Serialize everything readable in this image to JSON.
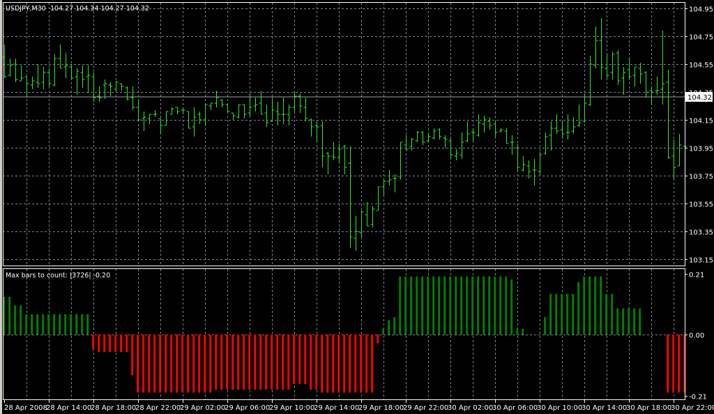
{
  "header": {
    "symbol": "USDJPY,M30",
    "ohlc": "104.27 104.34 104.27 104.32"
  },
  "indicator": {
    "label": "Max bars to count: |3726|  -0.20"
  },
  "current_price_label": "104.32",
  "colors": {
    "background": "#000000",
    "bar": "#32e632",
    "grid": "#778899",
    "positive_histogram": "#008000",
    "negative_histogram": "#ff0000",
    "bid_line": "#a0a0a0",
    "axis_text": "#ffffff"
  },
  "chart_data": [
    {
      "type": "ohlc",
      "symbol": "USDJPY",
      "timeframe": "M30",
      "ylim": [
        103.15,
        104.95
      ],
      "y_ticks": [
        "104.95",
        "104.75",
        "104.55",
        "104.35",
        "104.15",
        "103.95",
        "103.75",
        "103.55",
        "103.35",
        "103.15"
      ],
      "grid": true,
      "bid_line": 104.32,
      "x_tick_labels": [
        "28 Apr 2008",
        "28 Apr 14:00",
        "28 Apr 18:00",
        "28 Apr 22:00",
        "29 Apr 02:00",
        "29 Apr 06:00",
        "29 Apr 10:00",
        "29 Apr 14:00",
        "29 Apr 18:00",
        "29 Apr 22:00",
        "30 Apr 02:00",
        "30 Apr 06:00",
        "30 Apr 10:00",
        "30 Apr 14:00",
        "30 Apr 18:00",
        "30 Apr 22:00"
      ],
      "columns": [
        "time",
        "open",
        "high",
        "low",
        "close"
      ],
      "bars": [
        [
          "2008-04-28 10:00",
          104.6,
          104.69,
          104.45,
          104.46
        ],
        [
          "2008-04-28 10:30",
          104.47,
          104.59,
          104.46,
          104.54
        ],
        [
          "2008-04-28 11:00",
          104.55,
          104.59,
          104.42,
          104.44
        ],
        [
          "2008-04-28 11:30",
          104.43,
          104.54,
          104.43,
          104.45
        ],
        [
          "2008-04-28 12:00",
          104.46,
          104.46,
          104.31,
          104.41
        ],
        [
          "2008-04-28 12:30",
          104.4,
          104.46,
          104.37,
          104.43
        ],
        [
          "2008-04-28 13:00",
          104.42,
          104.55,
          104.38,
          104.41
        ],
        [
          "2008-04-28 13:30",
          104.42,
          104.53,
          104.37,
          104.49
        ],
        [
          "2008-04-28 14:00",
          104.49,
          104.52,
          104.39,
          104.41
        ],
        [
          "2008-04-28 14:30",
          104.4,
          104.62,
          104.39,
          104.59
        ],
        [
          "2008-04-28 15:00",
          104.59,
          104.69,
          104.52,
          104.52
        ],
        [
          "2008-04-28 15:30",
          104.53,
          104.63,
          104.45,
          104.54
        ],
        [
          "2008-04-28 16:00",
          104.53,
          104.55,
          104.44,
          104.45
        ],
        [
          "2008-04-28 16:30",
          104.46,
          104.52,
          104.33,
          104.5
        ],
        [
          "2008-04-28 17:00",
          104.49,
          104.54,
          104.38,
          104.44
        ],
        [
          "2008-04-28 17:30",
          104.46,
          104.54,
          104.34,
          104.47
        ],
        [
          "2008-04-28 18:00",
          104.46,
          104.49,
          104.28,
          104.31
        ],
        [
          "2008-04-28 18:30",
          104.32,
          104.39,
          104.28,
          104.31
        ],
        [
          "2008-04-28 19:00",
          104.4,
          104.44,
          104.3,
          104.41
        ],
        [
          "2008-04-28 19:30",
          104.4,
          104.42,
          104.32,
          104.39
        ],
        [
          "2008-04-28 20:00",
          104.37,
          104.43,
          104.36,
          104.42
        ],
        [
          "2008-04-28 20:30",
          104.41,
          104.41,
          104.36,
          104.39
        ],
        [
          "2008-04-28 21:00",
          104.38,
          104.39,
          104.29,
          104.3
        ],
        [
          "2008-04-28 21:30",
          104.31,
          104.39,
          104.22,
          104.24
        ],
        [
          "2008-04-28 22:00",
          104.24,
          104.29,
          104.14,
          104.15
        ],
        [
          "2008-04-28 22:30",
          104.16,
          104.21,
          104.07,
          104.17
        ],
        [
          "2008-04-28 23:00",
          104.16,
          104.19,
          104.12,
          104.19
        ],
        [
          "2008-04-28 23:30",
          104.19,
          104.22,
          104.17,
          104.19
        ],
        [
          "2008-04-29 00:00",
          104.16,
          104.16,
          104.05,
          104.11
        ],
        [
          "2008-04-29 00:30",
          104.11,
          104.21,
          104.11,
          104.21
        ],
        [
          "2008-04-29 01:00",
          104.19,
          104.24,
          104.19,
          104.23
        ],
        [
          "2008-04-29 01:30",
          104.24,
          104.24,
          104.19,
          104.21
        ],
        [
          "2008-04-29 02:00",
          104.22,
          104.24,
          104.19,
          104.22
        ],
        [
          "2008-04-29 02:30",
          104.21,
          104.21,
          104.09,
          104.09
        ],
        [
          "2008-04-29 03:00",
          104.1,
          104.24,
          104.03,
          104.17
        ],
        [
          "2008-04-29 03:30",
          104.19,
          104.21,
          104.12,
          104.15
        ],
        [
          "2008-04-29 04:00",
          104.15,
          104.26,
          104.11,
          104.26
        ],
        [
          "2008-04-29 04:30",
          104.25,
          104.27,
          104.22,
          104.27
        ],
        [
          "2008-04-29 05:00",
          104.27,
          104.36,
          104.24,
          104.31
        ],
        [
          "2008-04-29 05:30",
          104.29,
          104.3,
          104.24,
          104.26
        ],
        [
          "2008-04-29 06:00",
          104.26,
          104.26,
          104.21,
          104.21
        ],
        [
          "2008-04-29 06:30",
          104.2,
          104.2,
          104.15,
          104.18
        ],
        [
          "2008-04-29 07:00",
          104.17,
          104.26,
          104.16,
          104.26
        ],
        [
          "2008-04-29 07:30",
          104.26,
          104.26,
          104.16,
          104.19
        ],
        [
          "2008-04-29 08:00",
          104.2,
          104.34,
          104.18,
          104.24
        ],
        [
          "2008-04-29 08:30",
          104.25,
          104.31,
          104.21,
          104.26
        ],
        [
          "2008-04-29 09:00",
          104.27,
          104.36,
          104.19,
          104.19
        ],
        [
          "2008-04-29 09:30",
          104.2,
          104.26,
          104.1,
          104.13
        ],
        [
          "2008-04-29 10:00",
          104.14,
          104.31,
          104.14,
          104.22
        ],
        [
          "2008-04-29 10:30",
          104.21,
          104.28,
          104.11,
          104.19
        ],
        [
          "2008-04-29 11:00",
          104.19,
          104.31,
          104.12,
          104.19
        ],
        [
          "2008-04-29 11:30",
          104.19,
          104.26,
          104.11,
          104.24
        ],
        [
          "2008-04-29 12:00",
          104.24,
          104.35,
          104.21,
          104.32
        ],
        [
          "2008-04-29 12:30",
          104.32,
          104.34,
          104.2,
          104.25
        ],
        [
          "2008-04-29 13:00",
          104.24,
          104.31,
          104.14,
          104.16
        ],
        [
          "2008-04-29 13:30",
          104.15,
          104.16,
          104.03,
          104.1
        ],
        [
          "2008-04-29 14:00",
          104.11,
          104.14,
          104.0,
          104.1
        ],
        [
          "2008-04-29 14:30",
          104.11,
          104.14,
          103.81,
          103.89
        ],
        [
          "2008-04-29 15:00",
          103.91,
          103.92,
          103.76,
          103.89
        ],
        [
          "2008-04-29 15:30",
          103.89,
          103.99,
          103.86,
          103.88
        ],
        [
          "2008-04-29 16:00",
          103.88,
          103.98,
          103.84,
          103.94
        ],
        [
          "2008-04-29 16:30",
          103.96,
          103.97,
          103.76,
          103.81
        ],
        [
          "2008-04-29 17:00",
          103.84,
          103.96,
          103.23,
          103.31
        ],
        [
          "2008-04-29 17:30",
          103.3,
          103.46,
          103.21,
          103.35
        ],
        [
          "2008-04-29 18:00",
          103.34,
          103.5,
          103.31,
          103.49
        ],
        [
          "2008-04-29 18:30",
          103.47,
          103.56,
          103.39,
          103.39
        ],
        [
          "2008-04-29 19:00",
          103.4,
          103.53,
          103.38,
          103.51
        ],
        [
          "2008-04-29 19:30",
          103.5,
          103.67,
          103.5,
          103.67
        ],
        [
          "2008-04-29 20:00",
          103.67,
          103.72,
          103.61,
          103.71
        ],
        [
          "2008-04-29 20:30",
          103.71,
          103.79,
          103.68,
          103.72
        ],
        [
          "2008-04-29 21:00",
          103.73,
          103.76,
          103.63,
          103.73
        ],
        [
          "2008-04-29 21:30",
          103.74,
          103.99,
          103.72,
          103.99
        ],
        [
          "2008-04-29 22:00",
          103.97,
          104.04,
          103.93,
          103.94
        ],
        [
          "2008-04-29 22:30",
          103.96,
          104.02,
          103.93,
          104.01
        ],
        [
          "2008-04-29 23:00",
          104.0,
          104.07,
          103.99,
          104.06
        ],
        [
          "2008-04-29 23:30",
          104.06,
          104.07,
          103.97,
          103.99
        ],
        [
          "2008-04-30 00:00",
          104.0,
          104.06,
          103.99,
          104.03
        ],
        [
          "2008-04-30 00:30",
          104.02,
          104.09,
          104.01,
          104.07
        ],
        [
          "2008-04-30 01:00",
          104.08,
          104.09,
          104.01,
          104.03
        ],
        [
          "2008-04-30 01:30",
          104.02,
          104.04,
          103.95,
          104.01
        ],
        [
          "2008-04-30 02:00",
          104.0,
          104.02,
          103.87,
          103.9
        ],
        [
          "2008-04-30 02:30",
          103.89,
          103.94,
          103.86,
          103.91
        ],
        [
          "2008-04-30 03:00",
          103.9,
          104.06,
          103.87,
          103.99
        ],
        [
          "2008-04-30 03:30",
          104.0,
          104.14,
          103.99,
          104.05
        ],
        [
          "2008-04-30 04:00",
          104.06,
          104.09,
          104.0,
          104.06
        ],
        [
          "2008-04-30 04:30",
          104.04,
          104.19,
          104.03,
          104.13
        ],
        [
          "2008-04-30 05:00",
          104.12,
          104.18,
          104.06,
          104.15
        ],
        [
          "2008-04-30 05:30",
          104.14,
          104.17,
          104.08,
          104.11
        ],
        [
          "2008-04-30 06:00",
          104.12,
          104.14,
          104.03,
          104.06
        ],
        [
          "2008-04-30 06:30",
          104.07,
          104.09,
          104.06,
          104.08
        ],
        [
          "2008-04-30 07:00",
          104.07,
          104.09,
          103.98,
          103.98
        ],
        [
          "2008-04-30 07:30",
          103.99,
          104.04,
          103.9,
          103.99
        ],
        [
          "2008-04-30 08:00",
          103.95,
          103.98,
          103.78,
          103.81
        ],
        [
          "2008-04-30 08:30",
          103.79,
          103.89,
          103.78,
          103.83
        ],
        [
          "2008-04-30 09:00",
          103.82,
          103.86,
          103.73,
          103.78
        ],
        [
          "2008-04-30 09:30",
          103.79,
          103.87,
          103.68,
          103.79
        ],
        [
          "2008-04-30 10:00",
          103.78,
          103.92,
          103.76,
          103.9
        ],
        [
          "2008-04-30 10:30",
          103.91,
          104.06,
          103.9,
          104.03
        ],
        [
          "2008-04-30 11:00",
          104.04,
          104.14,
          103.93,
          104.09
        ],
        [
          "2008-04-30 11:30",
          104.09,
          104.19,
          104.05,
          104.07
        ],
        [
          "2008-04-30 12:00",
          104.08,
          104.14,
          104.02,
          104.05
        ],
        [
          "2008-04-30 12:30",
          104.06,
          104.19,
          104.01,
          104.06
        ],
        [
          "2008-04-30 13:00",
          104.07,
          104.17,
          104.05,
          104.1
        ],
        [
          "2008-04-30 13:30",
          104.11,
          104.26,
          104.1,
          104.13
        ],
        [
          "2008-04-30 14:00",
          104.14,
          104.34,
          104.13,
          104.27
        ],
        [
          "2008-04-30 14:30",
          104.26,
          104.61,
          104.25,
          104.55
        ],
        [
          "2008-04-30 15:00",
          104.54,
          104.82,
          104.52,
          104.72
        ],
        [
          "2008-04-30 15:30",
          104.72,
          104.88,
          104.44,
          104.53
        ],
        [
          "2008-04-30 16:00",
          104.52,
          104.62,
          104.45,
          104.47
        ],
        [
          "2008-04-30 16:30",
          104.49,
          104.64,
          104.44,
          104.62
        ],
        [
          "2008-04-30 17:00",
          104.63,
          104.65,
          104.4,
          104.43
        ],
        [
          "2008-04-30 17:30",
          104.45,
          104.53,
          104.33,
          104.49
        ],
        [
          "2008-04-30 18:00",
          104.51,
          104.59,
          104.44,
          104.46
        ],
        [
          "2008-04-30 18:30",
          104.47,
          104.53,
          104.39,
          104.53
        ],
        [
          "2008-04-30 19:00",
          104.52,
          104.56,
          104.41,
          104.48
        ],
        [
          "2008-04-30 19:30",
          104.49,
          104.5,
          104.31,
          104.35
        ],
        [
          "2008-04-30 20:00",
          104.36,
          104.38,
          104.26,
          104.35
        ],
        [
          "2008-04-30 20:30",
          104.36,
          104.46,
          104.33,
          104.36
        ],
        [
          "2008-04-30 21:00",
          104.37,
          104.79,
          104.26,
          104.41
        ],
        [
          "2008-04-30 21:30",
          104.42,
          104.51,
          103.87,
          103.88
        ],
        [
          "2008-04-30 22:00",
          103.89,
          104.01,
          103.73,
          103.81
        ],
        [
          "2008-04-30 22:30",
          103.82,
          104.05,
          103.82,
          103.97
        ],
        [
          "2008-04-30 23:00",
          103.96,
          104.02,
          103.91,
          103.96
        ]
      ]
    },
    {
      "type": "bar",
      "ylim": [
        -0.21,
        0.21
      ],
      "y_ticks": [
        "0.21",
        "0.00",
        "-0.21"
      ],
      "values": [
        0.13,
        0.13,
        0.1,
        0.1,
        0.07,
        0.07,
        0.07,
        0.07,
        0.07,
        0.07,
        0.07,
        0.07,
        0.07,
        0.07,
        0.07,
        0.07,
        -0.05,
        -0.06,
        -0.06,
        -0.06,
        -0.06,
        -0.06,
        -0.06,
        -0.14,
        -0.2,
        -0.2,
        -0.2,
        -0.2,
        -0.2,
        -0.2,
        -0.2,
        -0.2,
        -0.2,
        -0.2,
        -0.2,
        -0.2,
        -0.2,
        -0.2,
        -0.19,
        -0.19,
        -0.19,
        -0.19,
        -0.19,
        -0.19,
        -0.19,
        -0.19,
        -0.19,
        -0.19,
        -0.19,
        -0.19,
        -0.19,
        -0.19,
        -0.17,
        -0.17,
        -0.17,
        -0.19,
        -0.19,
        -0.2,
        -0.2,
        -0.2,
        -0.2,
        -0.2,
        -0.2,
        -0.2,
        -0.2,
        -0.2,
        -0.2,
        -0.03,
        0.02,
        0.05,
        0.06,
        0.2,
        0.2,
        0.2,
        0.2,
        0.2,
        0.2,
        0.2,
        0.2,
        0.2,
        0.2,
        0.2,
        0.2,
        0.2,
        0.2,
        0.2,
        0.2,
        0.2,
        0.2,
        0.2,
        0.2,
        0.19,
        0.02,
        0.02,
        0,
        0,
        0,
        0.06,
        0.14,
        0.14,
        0.14,
        0.14,
        0.14,
        0.18,
        0.2,
        0.2,
        0.2,
        0.2,
        0.14,
        0.14,
        0.09,
        0.09,
        0.09,
        0.09,
        0.09,
        0,
        0,
        0,
        0,
        -0.2,
        -0.2,
        -0.2,
        -0.2
      ]
    }
  ]
}
